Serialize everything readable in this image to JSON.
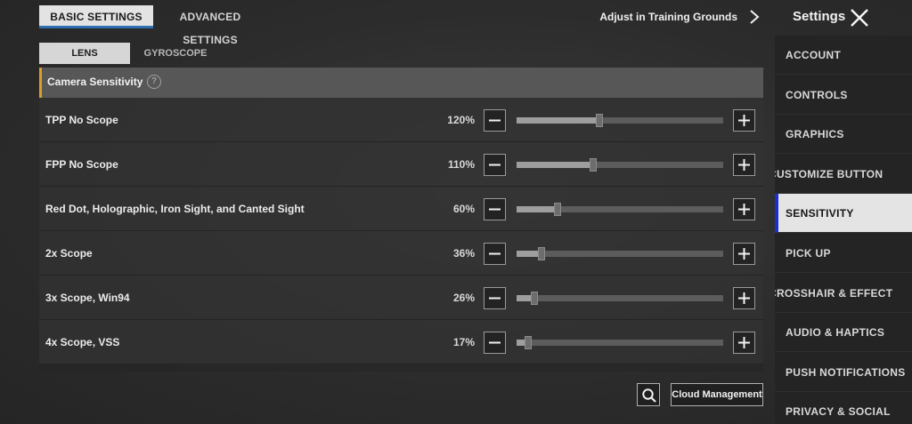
{
  "top_tabs": {
    "basic": "BASIC SETTINGS",
    "advanced": "ADVANCED SETTINGS"
  },
  "training_link": "Adjust in Training Grounds",
  "header": {
    "title": "Settings"
  },
  "sub_tabs": {
    "lens": "LENS",
    "gyroscope": "GYROSCOPE"
  },
  "section": {
    "title": "Camera Sensitivity",
    "help_glyph": "?"
  },
  "rows": [
    {
      "label": "TPP No Scope",
      "value_text": "120%",
      "fill_fraction": 0.4
    },
    {
      "label": "FPP No Scope",
      "value_text": "110%",
      "fill_fraction": 0.37
    },
    {
      "label": "Red Dot, Holographic, Iron Sight, and Canted Sight",
      "value_text": "60%",
      "fill_fraction": 0.2
    },
    {
      "label": "2x Scope",
      "value_text": "36%",
      "fill_fraction": 0.12
    },
    {
      "label": "3x Scope, Win94",
      "value_text": "26%",
      "fill_fraction": 0.085
    },
    {
      "label": "4x Scope, VSS",
      "value_text": "17%",
      "fill_fraction": 0.055
    }
  ],
  "bottom": {
    "cloud_button": "Cloud Management"
  },
  "nav": {
    "items": [
      {
        "label": "ACCOUNT"
      },
      {
        "label": "CONTROLS"
      },
      {
        "label": "GRAPHICS"
      },
      {
        "label": "CUSTOMIZE BUTTON"
      },
      {
        "label": "SENSITIVITY",
        "active": true
      },
      {
        "label": "PICK UP"
      },
      {
        "label": "CROSSHAIR & EFFECT"
      },
      {
        "label": "AUDIO & HAPTICS"
      },
      {
        "label": "PUSH NOTIFICATIONS"
      },
      {
        "label": "PRIVACY & SOCIAL"
      }
    ]
  },
  "colors": {
    "accent_blue": "#1b2fd1",
    "section_accent": "#d9a02b",
    "tab_underline": "#2f6fb0"
  },
  "icons": {
    "close": "close-icon",
    "chevron": "chevron-right-icon",
    "search": "search-icon",
    "minus": "minus-icon",
    "plus": "plus-icon",
    "help": "help-icon"
  }
}
